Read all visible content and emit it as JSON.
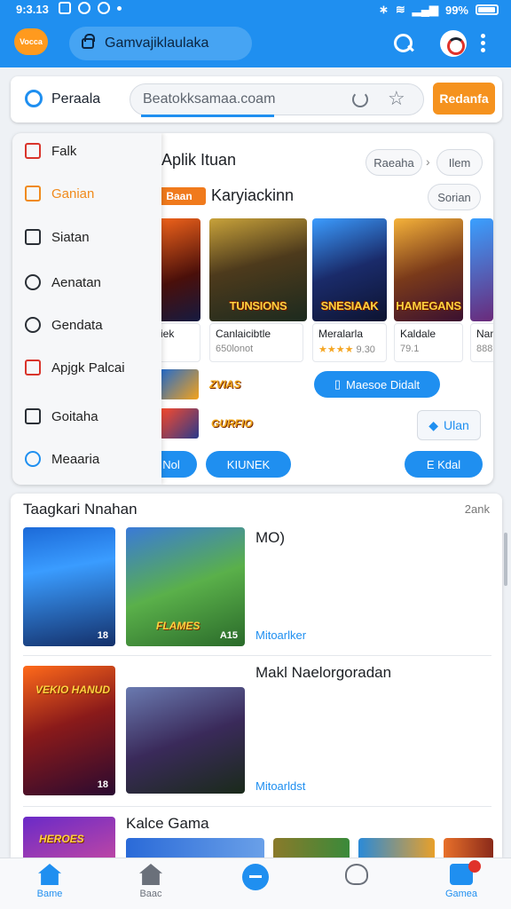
{
  "status_bar": {
    "time": "9:3.13",
    "battery": "99%"
  },
  "app_bar": {
    "logo_text": "Vocca",
    "search_text": "Gamvajiklaulaka"
  },
  "browser": {
    "page_title": "Peraala",
    "url": "Beatokksamaa.coam",
    "action_label": "Redanfa"
  },
  "side_menu": {
    "items": [
      {
        "label": "Falk",
        "icon": "flag-icon"
      },
      {
        "label": "Ganian",
        "icon": "calendar-icon"
      },
      {
        "label": "Siatan",
        "icon": "square-icon"
      },
      {
        "label": "Aenatan",
        "icon": "target-icon"
      },
      {
        "label": "Gendata",
        "icon": "heart-icon"
      },
      {
        "label": "Apjgk Palcai",
        "icon": "record-icon"
      },
      {
        "label": "Goitaha",
        "icon": "chat-icon"
      },
      {
        "label": "Meaaria",
        "icon": "person-icon"
      }
    ]
  },
  "panel": {
    "heading": "Aplik Ituan",
    "breadcrumb": [
      "Raeaha",
      "Ilem"
    ],
    "filter_label": "Sorian",
    "tag": "Baan",
    "section_title": "Karyiackinn",
    "games": [
      {
        "title": "",
        "meta_name": "iek",
        "meta_sub": ""
      },
      {
        "title": "TUNSIONS",
        "meta_name": "Canlaicibtle",
        "meta_sub": "650lonot"
      },
      {
        "title": "SNESIAAK",
        "meta_name": "Meralarla",
        "meta_sub": "9.30"
      },
      {
        "title": "HAMEGANS",
        "meta_name": "Kaldale",
        "meta_sub": "79.1"
      },
      {
        "title": "",
        "meta_name": "Nam",
        "meta_sub": "888"
      }
    ],
    "mini_logos": [
      "ZVIAS",
      "GURFIO"
    ],
    "pill_primary": "Maesoe Didalt",
    "outline_button": "Ulan",
    "bottom_pills": [
      "Nol",
      "KIUNEK",
      "E Kdal"
    ]
  },
  "list": {
    "heading": "Taagkari Nnahan",
    "count": "2ank",
    "rows": [
      {
        "title": "MO)",
        "subtitle": "Mitoarlker",
        "badge_a": "18",
        "badge_b": "A15",
        "art_title": "FLAMES"
      },
      {
        "title": "Makl Naelorgoradan",
        "subtitle": "Mitoarldst",
        "badge_a": "18",
        "badge_b": "",
        "art_title": "VEKIO HANUD"
      },
      {
        "title": "Kalce Gama",
        "subtitle": "",
        "art_title": "HEROES"
      }
    ]
  },
  "bottom_nav": {
    "items": [
      {
        "label": "Bame"
      },
      {
        "label": "Baac"
      },
      {
        "label": ""
      },
      {
        "label": ""
      },
      {
        "label": "Gamea"
      }
    ]
  },
  "colors": {
    "primary": "#1f8ff0",
    "accent": "#f5921e",
    "alert": "#e0322a"
  }
}
